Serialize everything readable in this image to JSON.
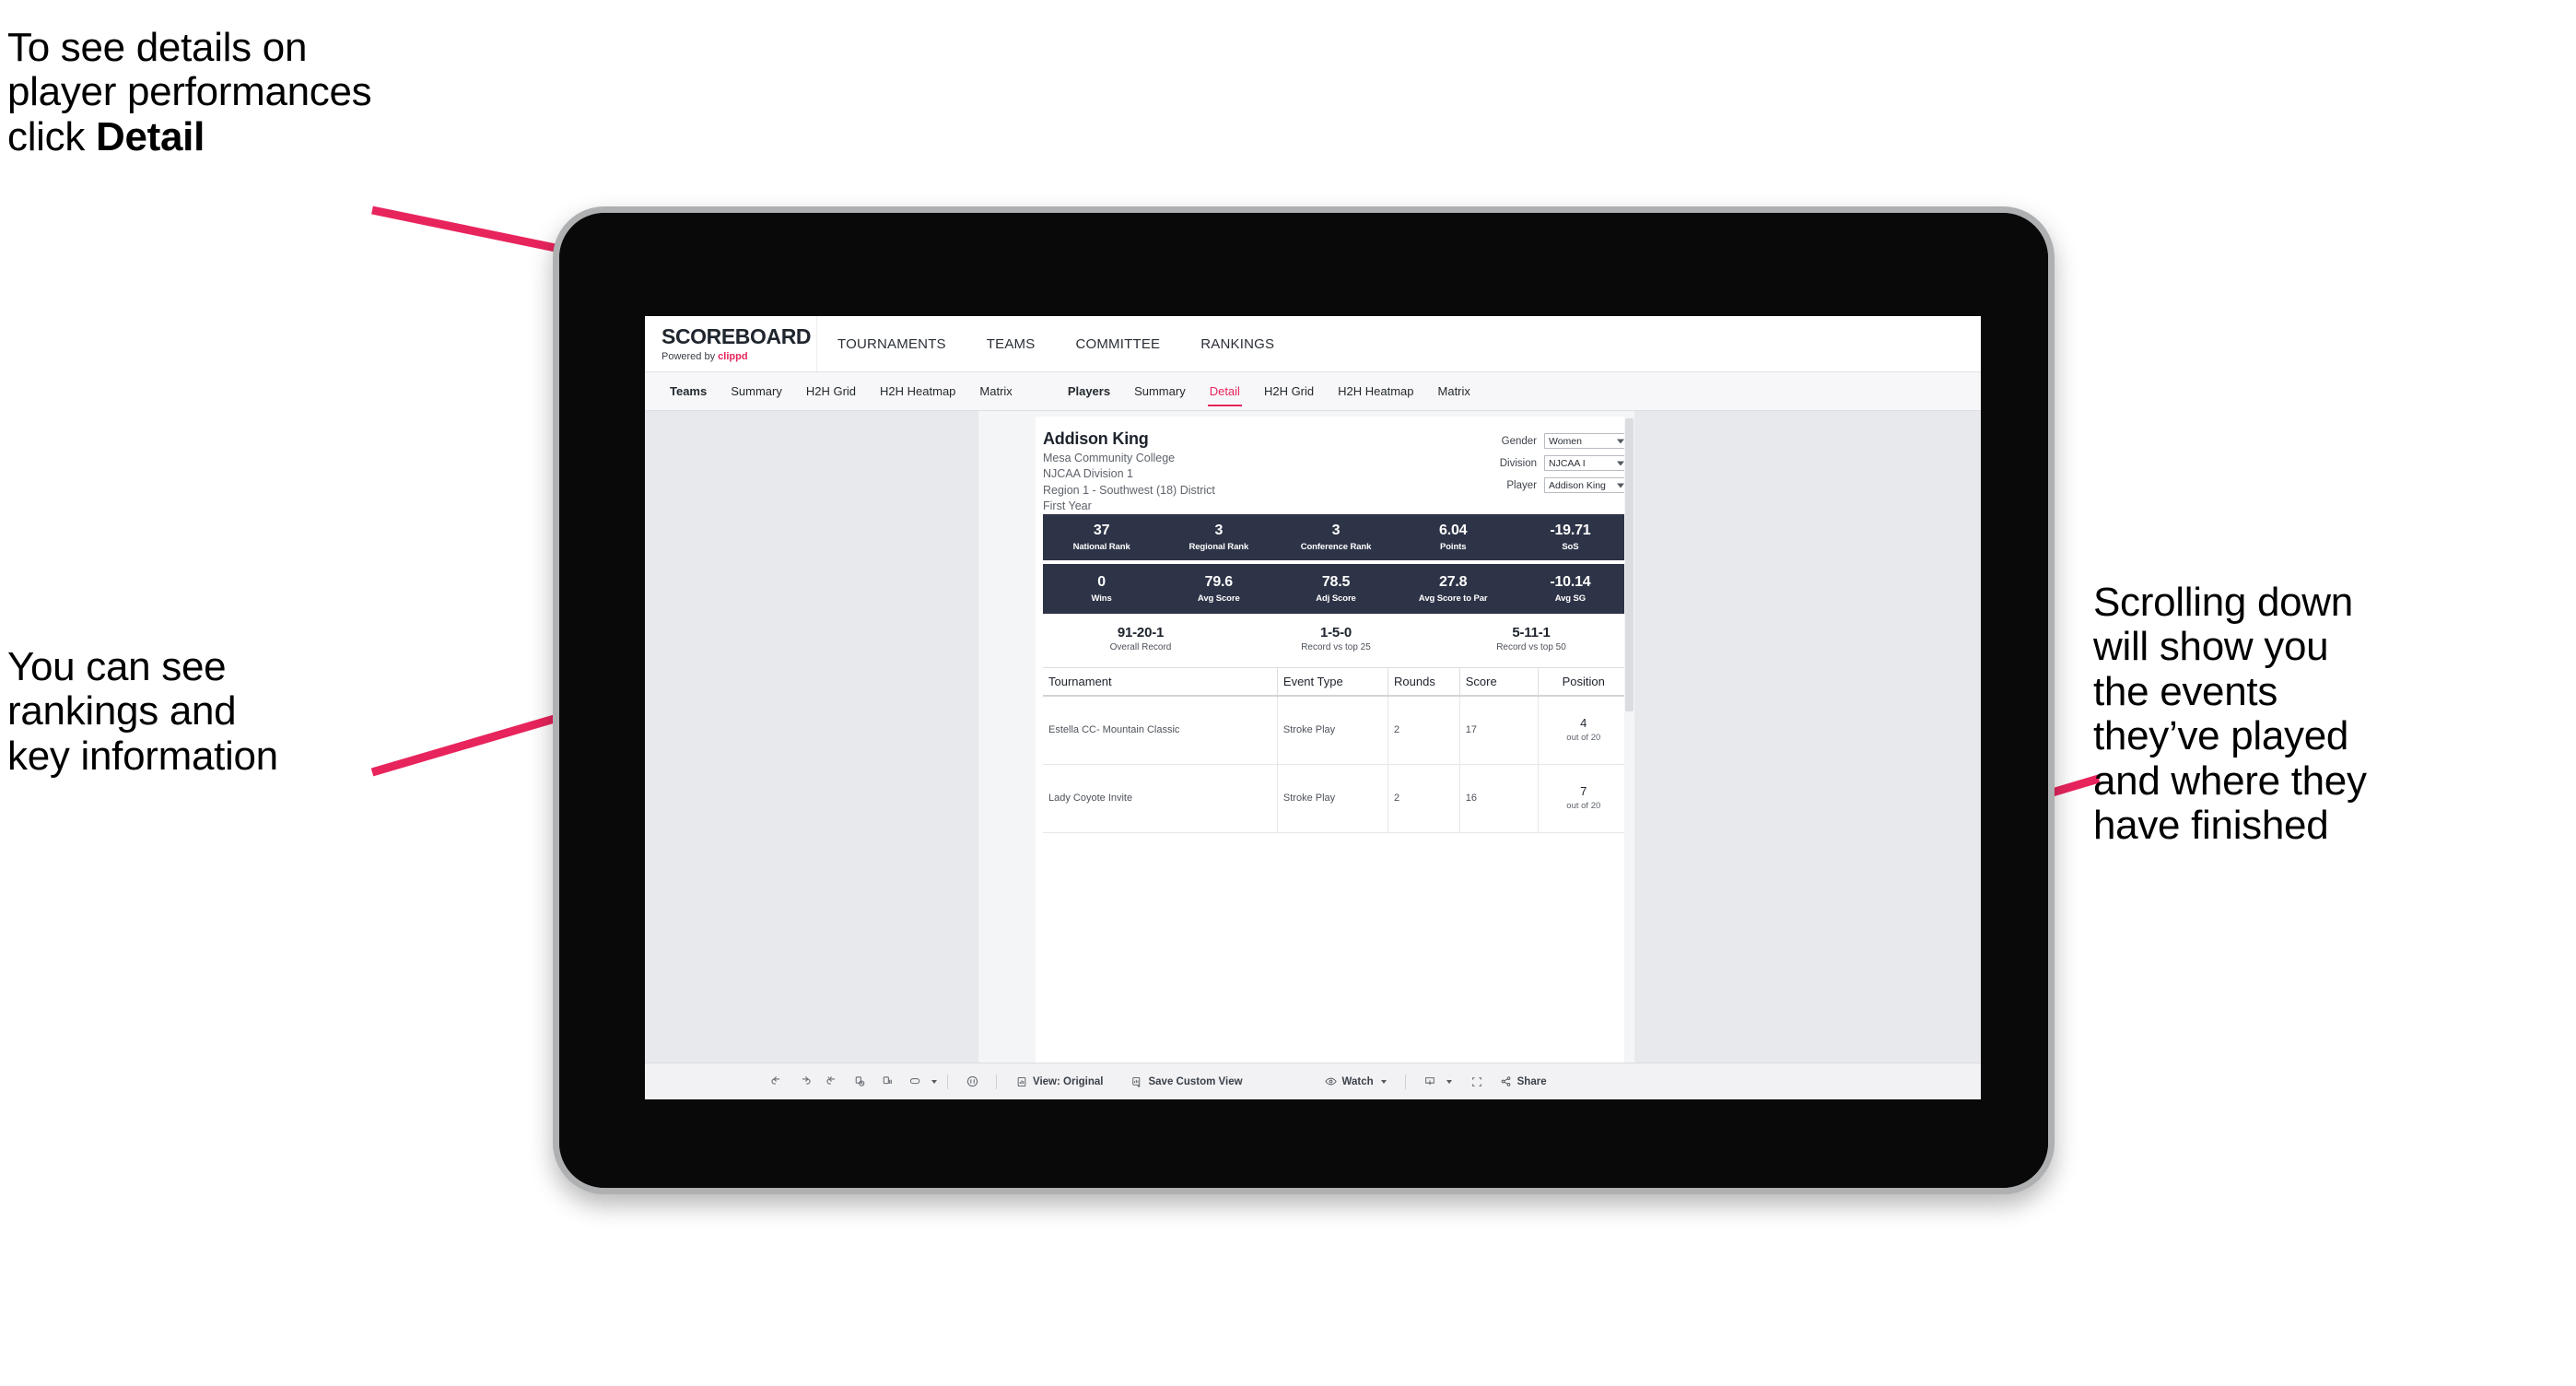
{
  "annotations": {
    "detail": {
      "line1": "To see details on",
      "line2": "player performances",
      "line3_pre": "click ",
      "line3_strong": "Detail"
    },
    "rankings": {
      "line1": "You can see",
      "line2": "rankings and",
      "line3": "key information"
    },
    "scroll": {
      "line1": "Scrolling down",
      "line2": "will show you",
      "line3": "the events",
      "line4": "they’ve played",
      "line5": "and where they",
      "line6": "have finished"
    }
  },
  "app": {
    "brand": {
      "name": "SCOREBOARD",
      "powered_prefix": "Powered by ",
      "powered_by": "clippd"
    },
    "topnav": [
      {
        "label": "TOURNAMENTS"
      },
      {
        "label": "TEAMS"
      },
      {
        "label": "COMMITTEE"
      },
      {
        "label": "RANKINGS"
      }
    ],
    "subnav": {
      "teams_group": [
        {
          "label": "Teams",
          "head": true,
          "active": false
        },
        {
          "label": "Summary",
          "head": false,
          "active": false
        },
        {
          "label": "H2H Grid",
          "head": false,
          "active": false
        },
        {
          "label": "H2H Heatmap",
          "head": false,
          "active": false
        },
        {
          "label": "Matrix",
          "head": false,
          "active": false
        }
      ],
      "players_group": [
        {
          "label": "Players",
          "head": true,
          "active": false
        },
        {
          "label": "Summary",
          "head": false,
          "active": false
        },
        {
          "label": "Detail",
          "head": false,
          "active": true
        },
        {
          "label": "H2H Grid",
          "head": false,
          "active": false
        },
        {
          "label": "H2H Heatmap",
          "head": false,
          "active": false
        },
        {
          "label": "Matrix",
          "head": false,
          "active": false
        }
      ]
    }
  },
  "player": {
    "name": "Addison King",
    "school": "Mesa Community College",
    "division": "NJCAA Division 1",
    "region": "Region 1 - Southwest (18) District",
    "year": "First Year"
  },
  "filters": [
    {
      "label": "Gender",
      "value": "Women"
    },
    {
      "label": "Division",
      "value": "NJCAA I"
    },
    {
      "label": "Player",
      "value": "Addison King"
    }
  ],
  "stats_row_1": [
    {
      "value": "37",
      "label": "National Rank"
    },
    {
      "value": "3",
      "label": "Regional Rank"
    },
    {
      "value": "3",
      "label": "Conference Rank"
    },
    {
      "value": "6.04",
      "label": "Points"
    },
    {
      "value": "-19.71",
      "label": "SoS"
    }
  ],
  "stats_row_2": [
    {
      "value": "0",
      "label": "Wins"
    },
    {
      "value": "79.6",
      "label": "Avg Score"
    },
    {
      "value": "78.5",
      "label": "Adj Score"
    },
    {
      "value": "27.8",
      "label": "Avg Score to Par"
    },
    {
      "value": "-10.14",
      "label": "Avg SG"
    }
  ],
  "records": [
    {
      "value": "91-20-1",
      "label": "Overall Record"
    },
    {
      "value": "1-5-0",
      "label": "Record vs top 25"
    },
    {
      "value": "5-11-1",
      "label": "Record vs top 50"
    }
  ],
  "events_table": {
    "columns": [
      "Tournament",
      "Event Type",
      "Rounds",
      "Score",
      "Position"
    ],
    "rows": [
      {
        "tournament": "Estella CC- Mountain Classic",
        "event_type": "Stroke Play",
        "rounds": "2",
        "score": "17",
        "position": "4",
        "position_of": "out of 20"
      },
      {
        "tournament": "Lady Coyote Invite",
        "event_type": "Stroke Play",
        "rounds": "2",
        "score": "16",
        "position": "7",
        "position_of": "out of 20"
      }
    ]
  },
  "toolbar": {
    "icons": [
      "undo-icon",
      "redo-icon",
      "revert-icon",
      "refresh-icon",
      "pause-icon",
      "loop-icon"
    ],
    "view_label": "View: Original",
    "save_label": "Save Custom View",
    "watch_label": "Watch",
    "share_label": "Share"
  },
  "colors": {
    "accent": "#e8245c",
    "band": "#2e3447",
    "canvas": "#e8e9ec",
    "arrow": "#e8245c"
  }
}
